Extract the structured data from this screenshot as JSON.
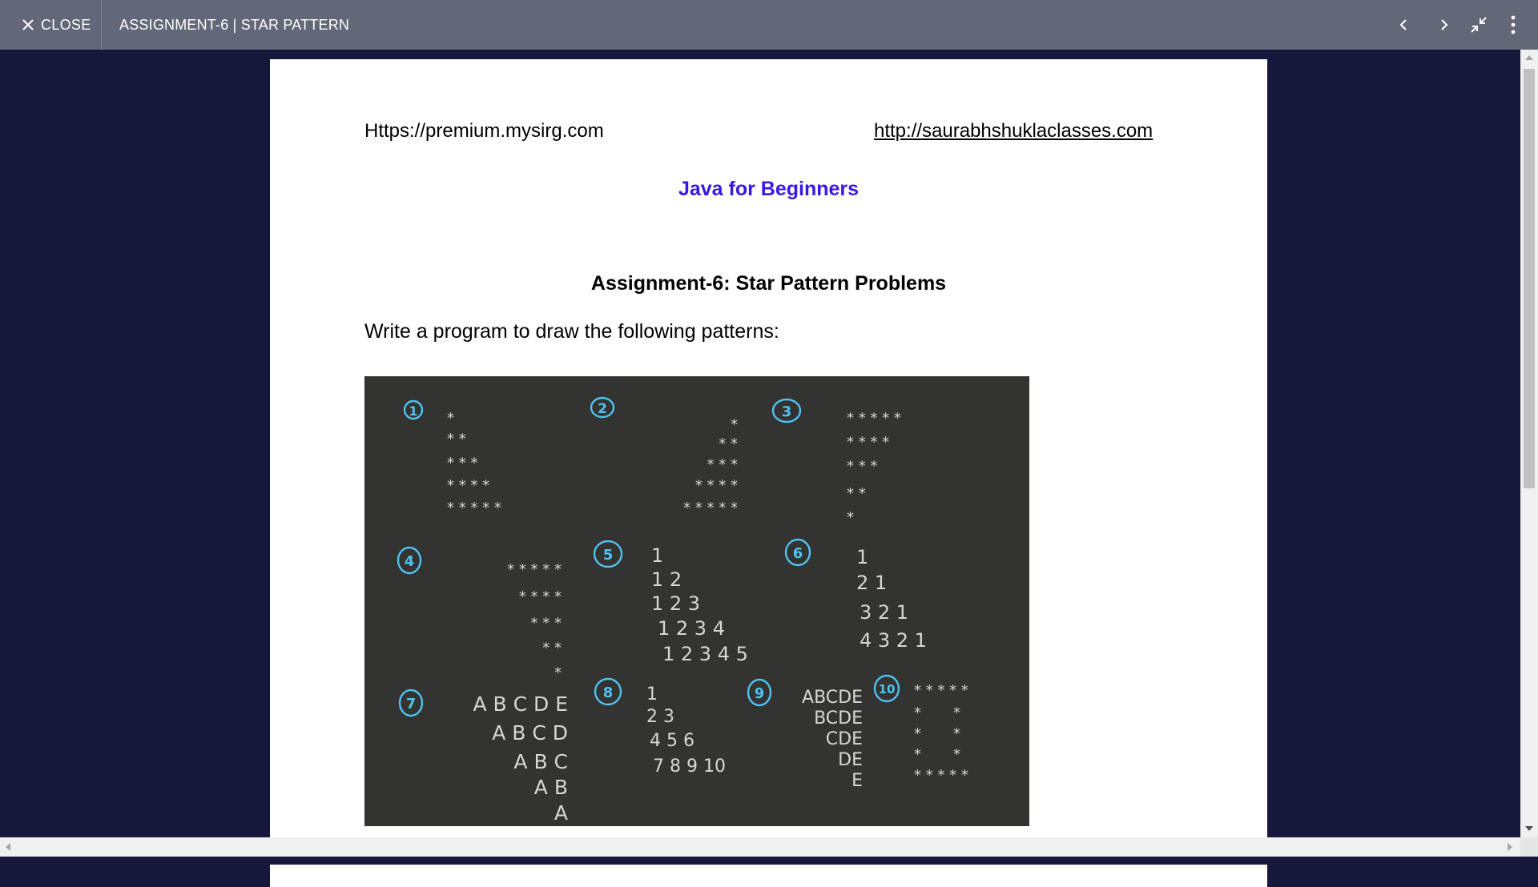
{
  "toolbar": {
    "close_label": "CLOSE",
    "title": "ASSIGNMENT-6 | STAR PATTERN",
    "icons": [
      "close-icon",
      "chevron-left-icon",
      "chevron-right-icon",
      "exit-fullscreen-icon",
      "more-vertical-icon"
    ]
  },
  "document": {
    "link_left": "Https://premium.mysirg.com",
    "link_right": "http://saurabhshuklaclasses.com",
    "course_title": "Java for Beginners",
    "course_title_color": "#3a17e6",
    "assignment_title": "Assignment-6: Star Pattern Problems",
    "instruction": "Write a program to draw the following patterns:",
    "patterns": [
      {
        "number": "1",
        "rows": [
          "*",
          "* *",
          "* * *",
          "* * * *",
          "* * * * *"
        ]
      },
      {
        "number": "2",
        "rows": [
          "*",
          "* *",
          "* * *",
          "* * * *",
          "* * * * *"
        ]
      },
      {
        "number": "3",
        "rows": [
          "* * * * *",
          "* * * *",
          "* * *",
          "* *",
          "*"
        ]
      },
      {
        "number": "4",
        "rows": [
          "* * * * *",
          "* * * *",
          "* * *",
          "* *",
          "*"
        ]
      },
      {
        "number": "5",
        "rows": [
          "1",
          "1 2",
          "1 2 3",
          "1 2 3 4",
          "1 2 3 4 5"
        ]
      },
      {
        "number": "6",
        "rows": [
          "1",
          "2 1",
          "3 2 1",
          "4 3 2 1"
        ]
      },
      {
        "number": "7",
        "rows": [
          "A B C D E",
          "A B C D",
          "A B C",
          "A B",
          "A"
        ]
      },
      {
        "number": "8",
        "rows": [
          "1",
          "2 3",
          "4 5 6",
          "7 8 9 10"
        ]
      },
      {
        "number": "9",
        "rows": [
          "ABCDE",
          "BCDE",
          "CDE",
          "DE",
          "E"
        ]
      },
      {
        "number": "10",
        "rows": [
          "* * * * *",
          "*       *",
          "*       *",
          "*       *",
          "* * * * *"
        ]
      }
    ]
  },
  "colors": {
    "toolbar_bg": "#636879",
    "viewer_bg": "#15183a",
    "board_bg": "#333331",
    "number_circle": "#4fc3ef",
    "chalk": "#d6d6d6"
  }
}
